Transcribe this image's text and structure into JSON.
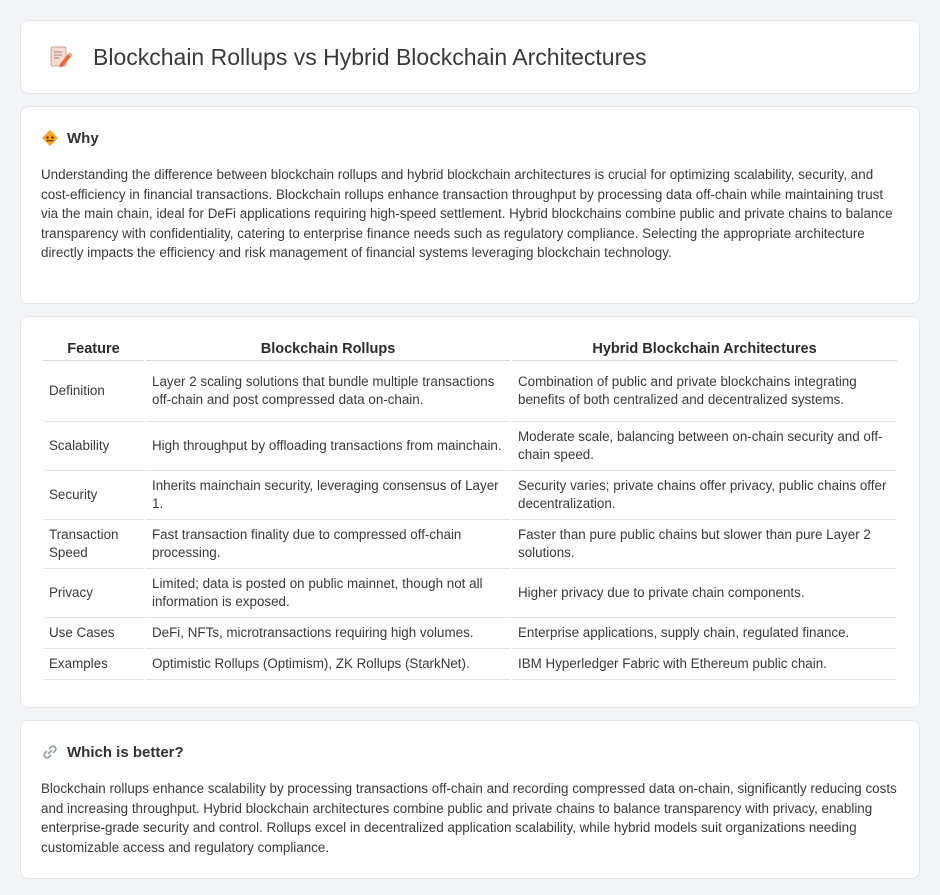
{
  "header": {
    "title": "Blockchain Rollups vs Hybrid Blockchain Architectures",
    "icon": "document-pencil-icon"
  },
  "why": {
    "heading": "Why",
    "icon": "warning-diamond-icon",
    "text": "Understanding the difference between blockchain rollups and hybrid blockchain architectures is crucial for optimizing scalability, security, and cost-efficiency in financial transactions. Blockchain rollups enhance transaction throughput by processing data off-chain while maintaining trust via the main chain, ideal for DeFi applications requiring high-speed settlement. Hybrid blockchains combine public and private chains to balance transparency with confidentiality, catering to enterprise finance needs such as regulatory compliance. Selecting the appropriate architecture directly impacts the efficiency and risk management of financial systems leveraging blockchain technology."
  },
  "table": {
    "headers": [
      "Feature",
      "Blockchain Rollups",
      "Hybrid Blockchain Architectures"
    ],
    "rows": [
      [
        "Definition",
        "Layer 2 scaling solutions that bundle multiple transactions off-chain and post compressed data on-chain.",
        "Combination of public and private blockchains integrating benefits of both centralized and decentralized systems."
      ],
      [
        "Scalability",
        "High throughput by offloading transactions from mainchain.",
        "Moderate scale, balancing between on-chain security and off-chain speed."
      ],
      [
        "Security",
        "Inherits mainchain security, leveraging consensus of Layer 1.",
        "Security varies; private chains offer privacy, public chains offer decentralization."
      ],
      [
        "Transaction Speed",
        "Fast transaction finality due to compressed off-chain processing.",
        "Faster than pure public chains but slower than pure Layer 2 solutions."
      ],
      [
        "Privacy",
        "Limited; data is posted on public mainnet, though not all information is exposed.",
        "Higher privacy due to private chain components."
      ],
      [
        "Use Cases",
        "DeFi, NFTs, microtransactions requiring high volumes.",
        "Enterprise applications, supply chain, regulated finance."
      ],
      [
        "Examples",
        "Optimistic Rollups (Optimism), ZK Rollups (StarkNet).",
        "IBM Hyperledger Fabric with Ethereum public chain."
      ]
    ]
  },
  "better": {
    "heading": "Which is better?",
    "icon": "link-icon",
    "text": "Blockchain rollups enhance scalability by processing transactions off-chain and recording compressed data on-chain, significantly reducing costs and increasing throughput. Hybrid blockchain architectures combine public and private chains to balance transparency with privacy, enabling enterprise-grade security and control. Rollups excel in decentralized application scalability, while hybrid models suit organizations needing customizable access and regulatory compliance."
  }
}
